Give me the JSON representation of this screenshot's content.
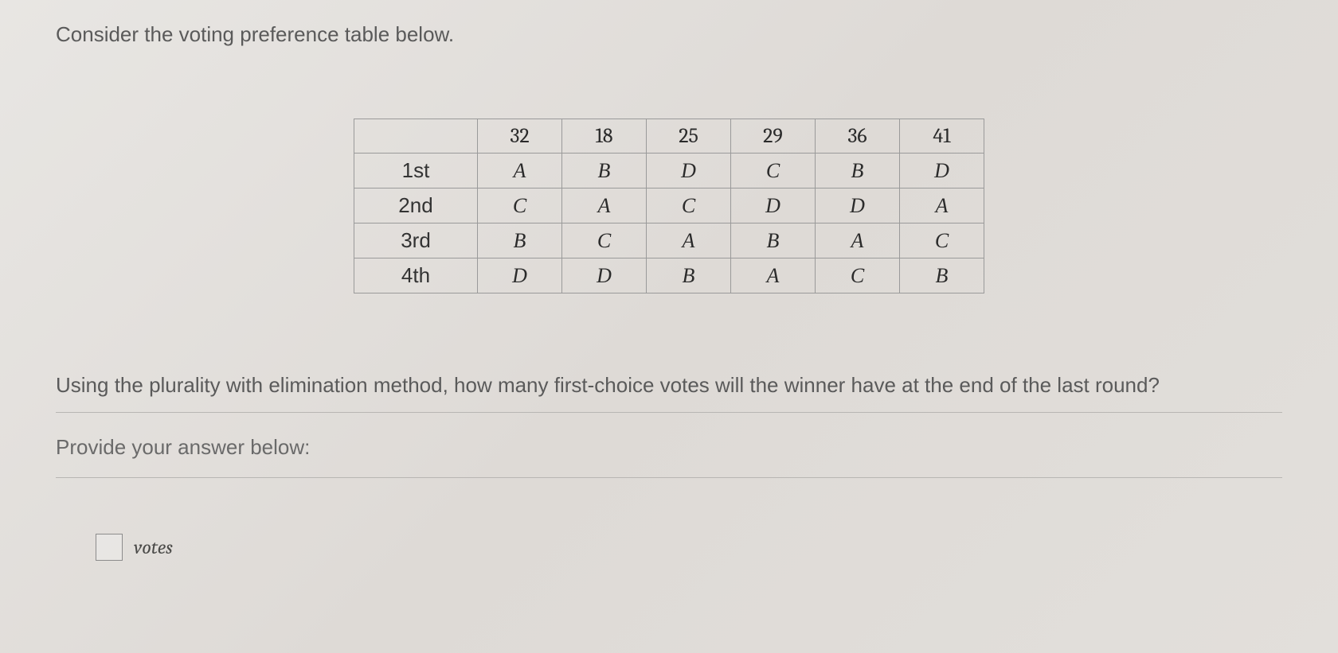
{
  "intro": "Consider the voting preference table below.",
  "table": {
    "counts": [
      "32",
      "18",
      "25",
      "29",
      "36",
      "41"
    ],
    "rows": [
      {
        "label": "1st",
        "cells": [
          "A",
          "B",
          "D",
          "C",
          "B",
          "D"
        ]
      },
      {
        "label": "2nd",
        "cells": [
          "C",
          "A",
          "C",
          "D",
          "D",
          "A"
        ]
      },
      {
        "label": "3rd",
        "cells": [
          "B",
          "C",
          "A",
          "B",
          "A",
          "C"
        ]
      },
      {
        "label": "4th",
        "cells": [
          "D",
          "D",
          "B",
          "A",
          "C",
          "B"
        ]
      }
    ]
  },
  "question": "Using the plurality with elimination method, how many first-choice votes will the winner have at the end of the last round?",
  "provide": "Provide your answer below:",
  "answer": {
    "value": "",
    "unit": "votes"
  }
}
